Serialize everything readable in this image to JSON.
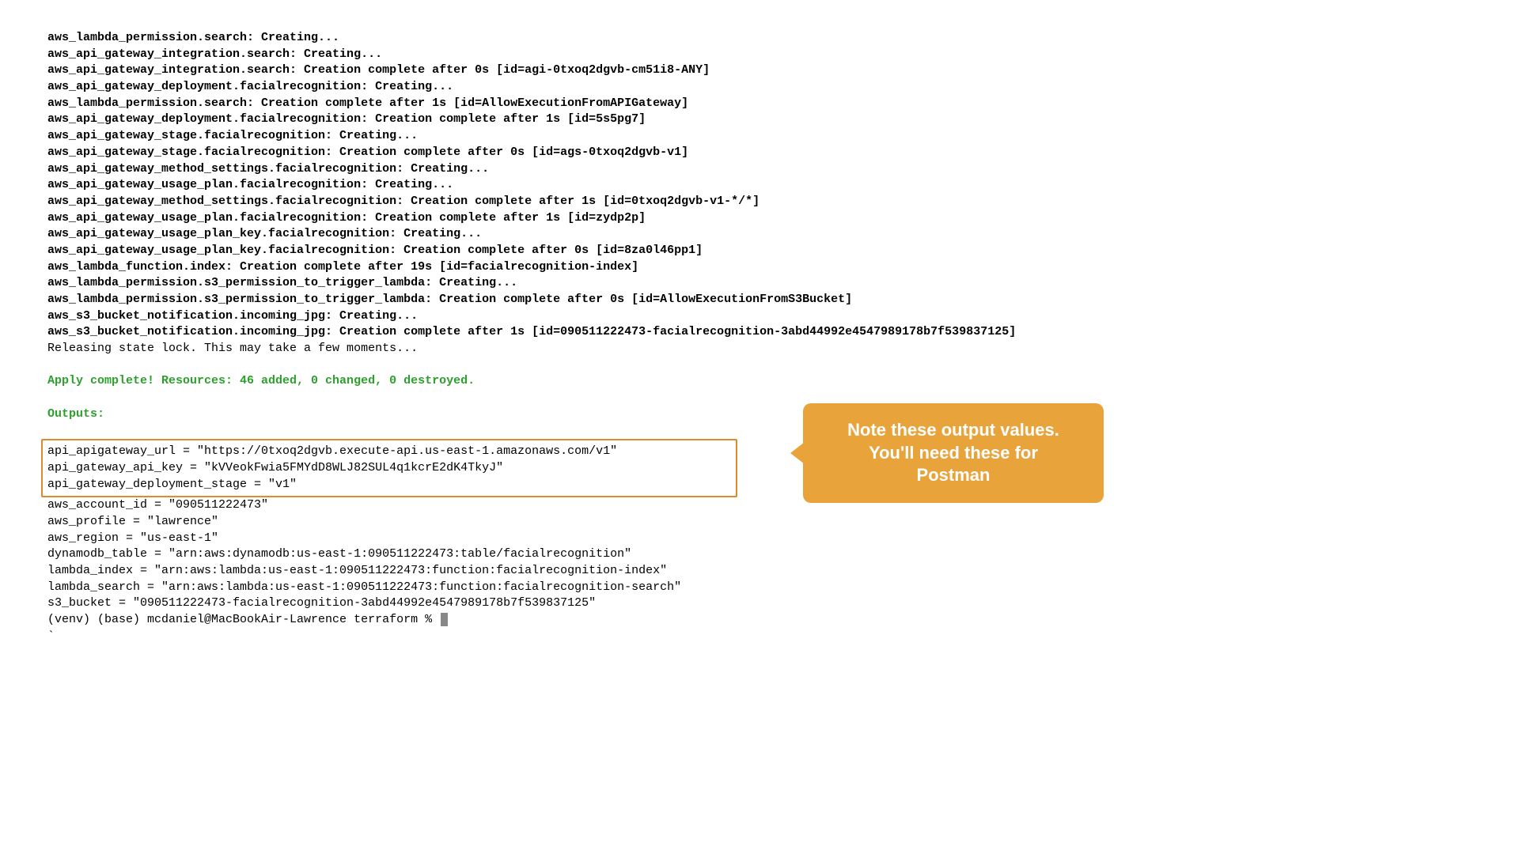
{
  "log": [
    "aws_lambda_permission.search: Creating...",
    "aws_api_gateway_integration.search: Creating...",
    "aws_api_gateway_integration.search: Creation complete after 0s [id=agi-0txoq2dgvb-cm51i8-ANY]",
    "aws_api_gateway_deployment.facialrecognition: Creating...",
    "aws_lambda_permission.search: Creation complete after 1s [id=AllowExecutionFromAPIGateway]",
    "aws_api_gateway_deployment.facialrecognition: Creation complete after 1s [id=5s5pg7]",
    "aws_api_gateway_stage.facialrecognition: Creating...",
    "aws_api_gateway_stage.facialrecognition: Creation complete after 0s [id=ags-0txoq2dgvb-v1]",
    "aws_api_gateway_method_settings.facialrecognition: Creating...",
    "aws_api_gateway_usage_plan.facialrecognition: Creating...",
    "aws_api_gateway_method_settings.facialrecognition: Creation complete after 1s [id=0txoq2dgvb-v1-*/*]",
    "aws_api_gateway_usage_plan.facialrecognition: Creation complete after 1s [id=zydp2p]",
    "aws_api_gateway_usage_plan_key.facialrecognition: Creating...",
    "aws_api_gateway_usage_plan_key.facialrecognition: Creation complete after 0s [id=8za0l46pp1]",
    "aws_lambda_function.index: Creation complete after 19s [id=facialrecognition-index]",
    "aws_lambda_permission.s3_permission_to_trigger_lambda: Creating...",
    "aws_lambda_permission.s3_permission_to_trigger_lambda: Creation complete after 0s [id=AllowExecutionFromS3Bucket]",
    "aws_s3_bucket_notification.incoming_jpg: Creating...",
    "aws_s3_bucket_notification.incoming_jpg: Creation complete after 1s [id=090511222473-facialrecognition-3abd44992e4547989178b7f539837125]"
  ],
  "release": "Releasing state lock. This may take a few moments...",
  "apply_complete": "Apply complete! Resources: 46 added, 0 changed, 0 destroyed.",
  "outputs_header": "Outputs:",
  "outputs_box": [
    "api_apigateway_url = \"https://0txoq2dgvb.execute-api.us-east-1.amazonaws.com/v1\"",
    "api_gateway_api_key = \"kVVeokFwia5FMYdD8WLJ82SUL4q1kcrE2dK4TkyJ\"",
    "api_gateway_deployment_stage = \"v1\""
  ],
  "outputs_rest": [
    "aws_account_id = \"090511222473\"",
    "aws_profile = \"lawrence\"",
    "aws_region = \"us-east-1\"",
    "dynamodb_table = \"arn:aws:dynamodb:us-east-1:090511222473:table/facialrecognition\"",
    "lambda_index = \"arn:aws:lambda:us-east-1:090511222473:function:facialrecognition-index\"",
    "lambda_search = \"arn:aws:lambda:us-east-1:090511222473:function:facialrecognition-search\"",
    "s3_bucket = \"090511222473-facialrecognition-3abd44992e4547989178b7f539837125\""
  ],
  "prompt": "(venv) (base) mcdaniel@MacBookAir-Lawrence terraform % ",
  "backtick": "`",
  "callout": {
    "line1": "Note these output values.",
    "line2": "You'll need these for",
    "line3": "Postman"
  }
}
